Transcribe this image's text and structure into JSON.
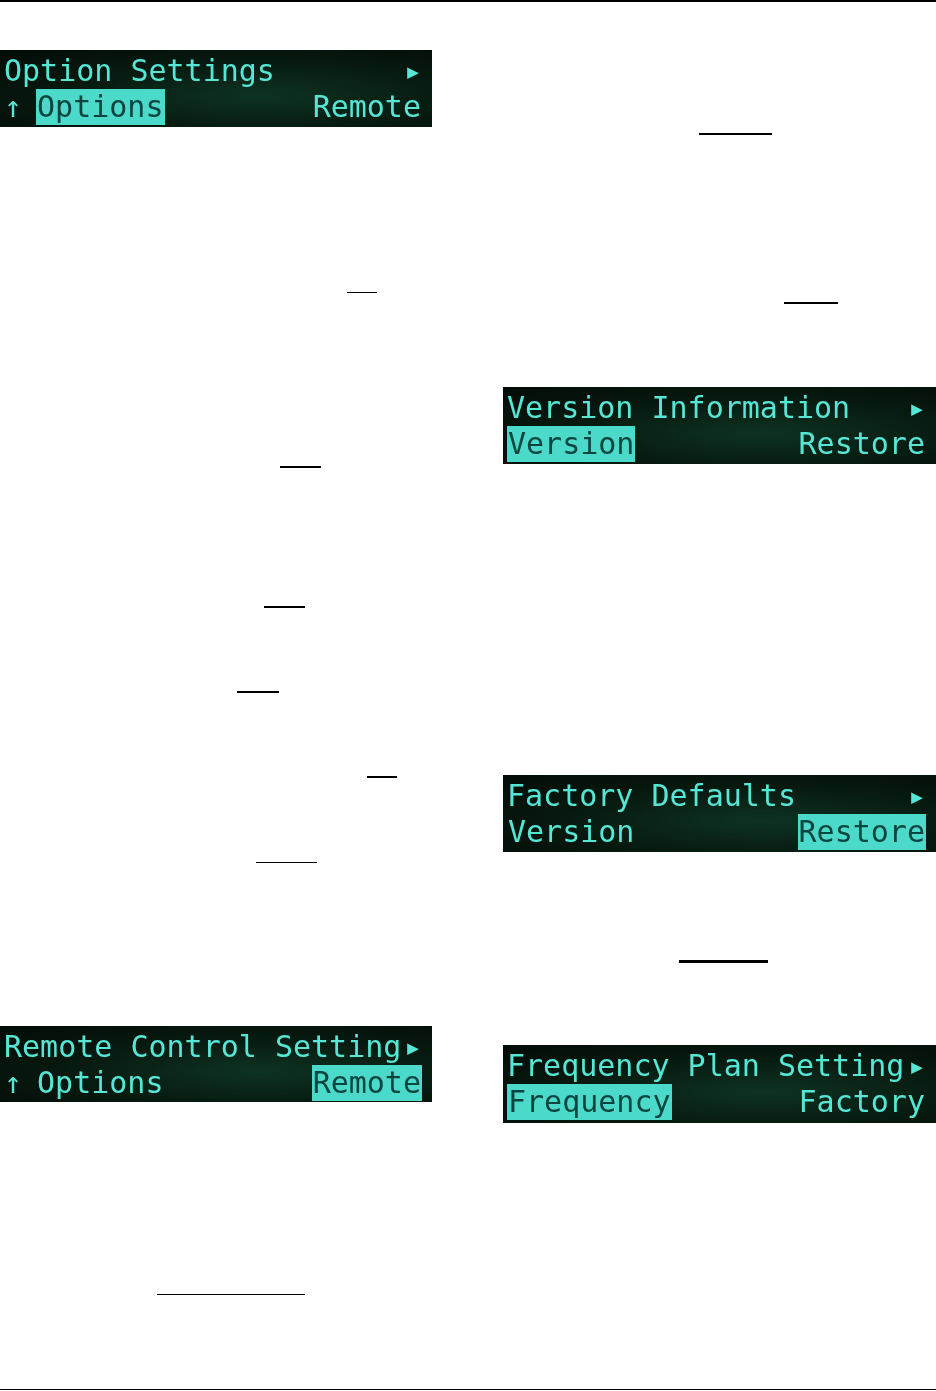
{
  "left_column": [
    {
      "kind": "display",
      "title": "Option Settings",
      "more_mark": "▸",
      "nav_mark": "↑",
      "options": [
        {
          "label": "Options",
          "selected": true
        },
        {
          "label": "Remote",
          "selected": false
        }
      ]
    },
    {
      "kind": "underline"
    },
    {
      "kind": "underline"
    },
    {
      "kind": "underline"
    },
    {
      "kind": "underline"
    },
    {
      "kind": "underline"
    },
    {
      "kind": "underline"
    },
    {
      "kind": "display",
      "title": "Remote Control Setting",
      "more_mark": "▸",
      "nav_mark": "↑",
      "options": [
        {
          "label": "Options",
          "selected": false
        },
        {
          "label": "Remote",
          "selected": true
        }
      ]
    },
    {
      "kind": "underline"
    }
  ],
  "right_column": [
    {
      "kind": "underline"
    },
    {
      "kind": "underline"
    },
    {
      "kind": "display",
      "title": "Version Information",
      "more_mark": "▸",
      "options": [
        {
          "label": "Version",
          "selected": true
        },
        {
          "label": "Restore",
          "selected": false
        }
      ]
    },
    {
      "kind": "display",
      "title": "Factory Defaults",
      "more_mark": "▸",
      "options": [
        {
          "label": "Version",
          "selected": false
        },
        {
          "label": "Restore",
          "selected": true
        }
      ]
    },
    {
      "kind": "underline"
    },
    {
      "kind": "display",
      "title": "Frequency Plan Setting",
      "more_mark": "▸",
      "options": [
        {
          "label": "Frequency",
          "selected": true
        },
        {
          "label": "Factory",
          "selected": false
        }
      ]
    }
  ]
}
